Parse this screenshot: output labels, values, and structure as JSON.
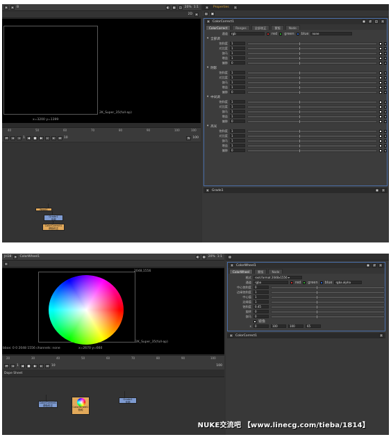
{
  "shot1": {
    "toolbar": {
      "frame_label": "B",
      "zoom": "20%",
      "ratio": "1:1",
      "props_tab": "Properties",
      "counter": "2D"
    },
    "viewer": {
      "format": "2K_Super_35(full-ap)",
      "coords": "x=3200 y=1399"
    },
    "timeline": {
      "ticks": [
        "40",
        "50",
        "60",
        "70",
        "80",
        "90",
        "100"
      ],
      "end": "100",
      "frame": "1",
      "step": "10",
      "fps": "100"
    },
    "nodes": {
      "read_label": "Read1",
      "grade_label": "Grade1",
      "grade_sub": "全部",
      "cc_label": "ColorCorrect1",
      "cc_sub": "调色校正"
    },
    "props": {
      "title": "ColorCorrect1",
      "tabs": [
        "ColorCorrect",
        "Ranges",
        "全部校正",
        "蒙版",
        "Node"
      ],
      "channels_label": "通道",
      "channels_value": "rgb",
      "ch_red": "red",
      "ch_green": "green",
      "ch_blue": "blue",
      "ch_none": "none",
      "sections": [
        {
          "name": "全部调",
          "rows": [
            "饱和度",
            "对比度",
            "伽马",
            "增益",
            "偏移"
          ],
          "vals": [
            "1",
            "1",
            "1",
            "1",
            "0"
          ]
        },
        {
          "name": "阴影",
          "rows": [
            "饱和度",
            "对比度",
            "伽马",
            "增益",
            "偏移"
          ],
          "vals": [
            "1",
            "1",
            "1",
            "1",
            "0"
          ]
        },
        {
          "name": "中间调",
          "rows": [
            "饱和度",
            "对比度",
            "伽马",
            "增益",
            "偏移"
          ],
          "vals": [
            "1",
            "1",
            "1",
            "1",
            "0"
          ]
        },
        {
          "name": "高光",
          "rows": [
            "饱和度",
            "对比度",
            "伽马",
            "增益",
            "偏移"
          ],
          "vals": [
            "1",
            "1",
            "1",
            "1",
            "0"
          ]
        }
      ],
      "second_title": "Grade1"
    }
  },
  "shot2": {
    "toolbar": {
      "viewer_name": "JH38",
      "node_name": "ColorWheel1",
      "zoom": "20%",
      "ratio": "1:1"
    },
    "viewer": {
      "format_top": "2048,1556",
      "format": "2K_Super_35(full-ap)",
      "bbox": "bbox: 0 0 2048 1556 channels: none",
      "coords": "x=2670 y=660"
    },
    "timeline": {
      "ticks": [
        "20",
        "30",
        "40",
        "50",
        "60",
        "70",
        "80",
        "90"
      ],
      "end": "100",
      "frame": "1",
      "step": "10",
      "fps": "100"
    },
    "dope_tab": "Dope Sheet",
    "nodes": {
      "cc_label": "ColorCorrect1",
      "cc_sub": "调色校正",
      "wheel_label": "ColorWheel1",
      "wheel_sub": "色轮",
      "grade_label": "Grade1",
      "grade_sub": "全部"
    },
    "props": {
      "title": "ColorWheel1",
      "tabs": [
        "ColorWheel",
        "蒙版",
        "Node"
      ],
      "format_label": "格式",
      "format_value": "root.format 2048x1556 ▾",
      "output_label": "通道",
      "output_value": "rgba",
      "ch_red": "red",
      "ch_green": "green",
      "ch_blue": "blue",
      "ch_alpha": "rgba.alpha",
      "rows": [
        {
          "label": "中心饱和度",
          "value": "0"
        },
        {
          "label": "边缘饱和度",
          "value": "1"
        },
        {
          "label": "中心值",
          "value": "1"
        },
        {
          "label": "边缘值",
          "value": "1"
        },
        {
          "label": "饱和度",
          "value": "0.45"
        },
        {
          "label": "旋转",
          "value": "0"
        }
      ],
      "gamma_label": "伽马",
      "gamma_value": "0",
      "checkbox_label": "镜像",
      "xy": {
        "x_label": "x",
        "x_value": "0",
        "x2": "100",
        "y": "100",
        "r": "65"
      },
      "second_title": "ColorCorrect1"
    }
  },
  "watermark": "NUKE交流吧 【www.linecg.com/tieba/1814】"
}
